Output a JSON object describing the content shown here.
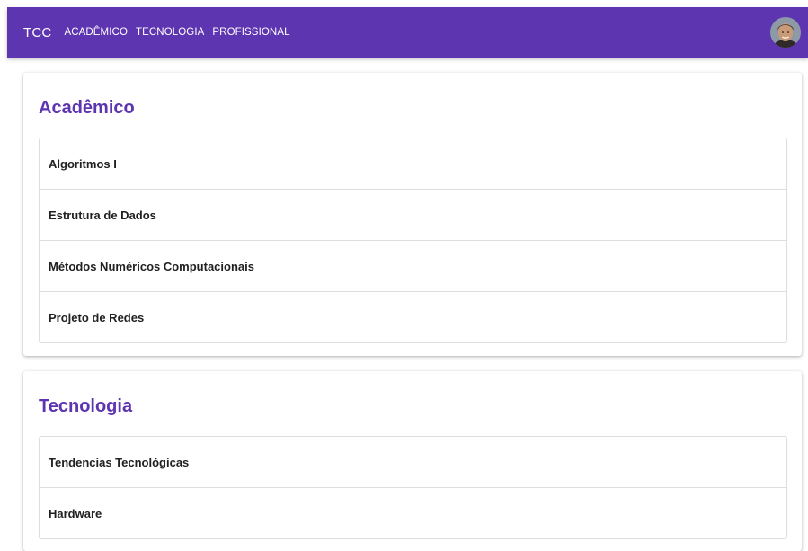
{
  "header": {
    "brand": "TCC",
    "nav": [
      {
        "label": "ACADÊMICO"
      },
      {
        "label": "TECNOLOGIA"
      },
      {
        "label": "PROFISSIONAL"
      }
    ],
    "avatar_icon": "user-avatar"
  },
  "sections": [
    {
      "title": "Acadêmico",
      "items": [
        {
          "label": "Algoritmos I"
        },
        {
          "label": "Estrutura de Dados"
        },
        {
          "label": "Métodos Numéricos Computacionais"
        },
        {
          "label": "Projeto de Redes"
        }
      ]
    },
    {
      "title": "Tecnologia",
      "items": [
        {
          "label": "Tendencias Tecnológicas"
        },
        {
          "label": "Hardware"
        }
      ]
    }
  ],
  "colors": {
    "primary": "#5e35b1",
    "text": "#212121",
    "border": "#dddddd"
  }
}
